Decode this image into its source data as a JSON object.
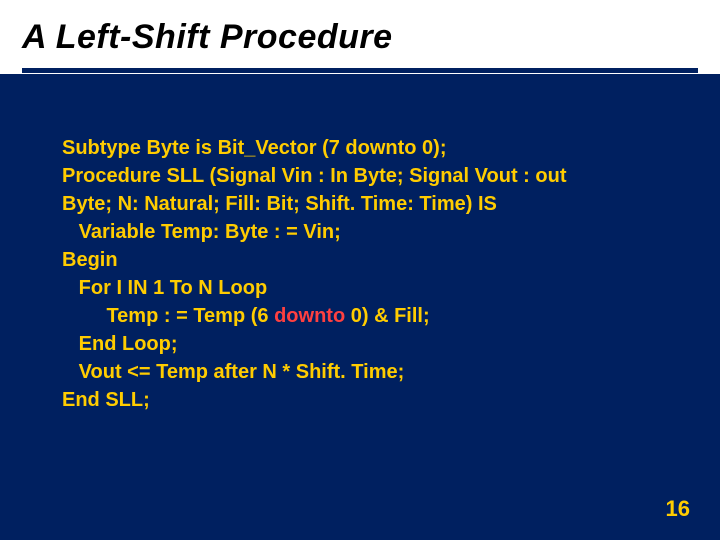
{
  "title": "A Left-Shift Procedure",
  "lines": {
    "l1": "Subtype Byte is Bit_Vector (7 downto 0);",
    "l2": "Procedure SLL (Signal Vin : In Byte; Signal Vout : out",
    "l3": "Byte; N: Natural; Fill: Bit; Shift. Time: Time) IS",
    "l4": "   Variable Temp: Byte : = Vin;",
    "l5": "Begin",
    "l6": "   For I IN 1 To N Loop",
    "l7a": "        Temp : = Temp (6 ",
    "l7b": "downto",
    "l7c": " 0) & Fill;",
    "l8": "   End Loop;",
    "l9": "   Vout <= Temp after N * Shift. Time;",
    "l10": "End SLL;"
  },
  "page_number": "16"
}
